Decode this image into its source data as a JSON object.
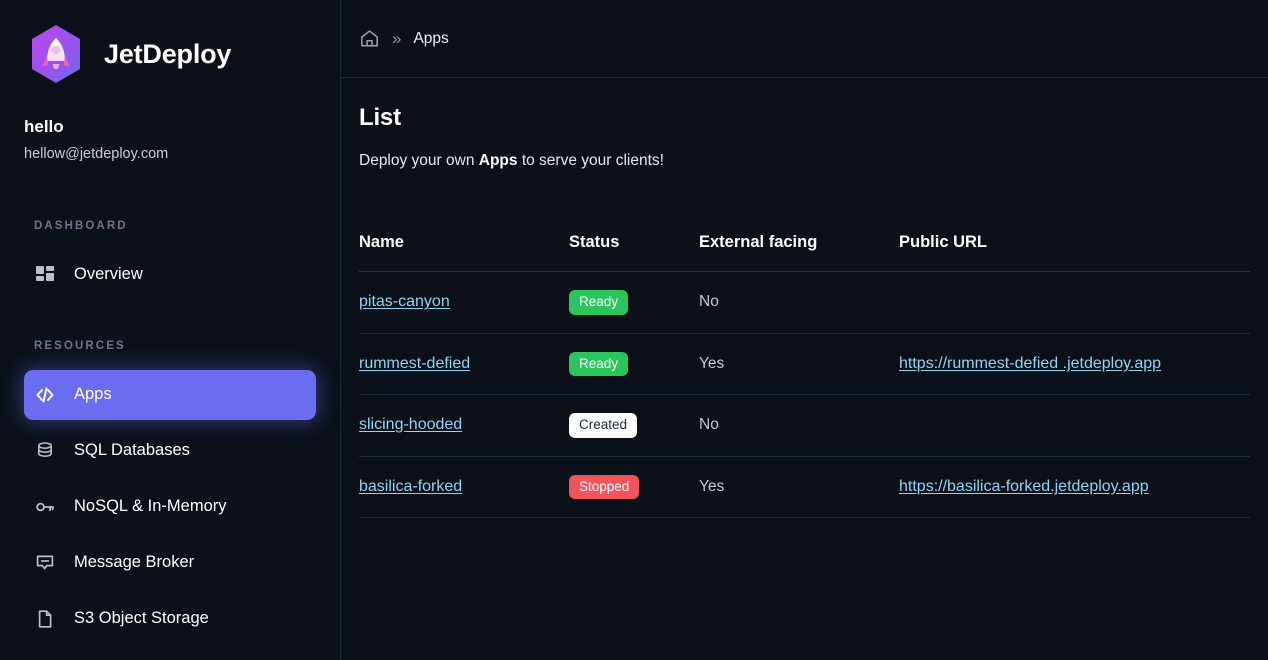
{
  "brand": {
    "name": "JetDeploy",
    "logo_icon": "rocket-hexagon-icon"
  },
  "account": {
    "name": "hello",
    "email": "hellow@jetdeploy.com"
  },
  "sidebar": {
    "sections": [
      {
        "label": "DASHBOARD",
        "items": [
          {
            "label": "Overview",
            "icon": "grid-dashboard-icon",
            "active": false
          }
        ]
      },
      {
        "label": "RESOURCES",
        "items": [
          {
            "label": "Apps",
            "icon": "code-brackets-icon",
            "active": true
          },
          {
            "label": "SQL Databases",
            "icon": "database-icon",
            "active": false
          },
          {
            "label": "NoSQL & In-Memory",
            "icon": "key-icon",
            "active": false
          },
          {
            "label": "Message Broker",
            "icon": "message-bubble-icon",
            "active": false
          },
          {
            "label": "S3 Object Storage",
            "icon": "file-document-icon",
            "active": false
          }
        ]
      }
    ]
  },
  "breadcrumb": {
    "home_icon": "home-icon",
    "separator": "»",
    "current": "Apps"
  },
  "page": {
    "title": "List",
    "subtitle_prefix": "Deploy your own ",
    "subtitle_bold": "Apps",
    "subtitle_suffix": " to serve your clients!"
  },
  "table": {
    "columns": [
      "Name",
      "Status",
      "External facing",
      "Public URL"
    ],
    "rows": [
      {
        "name": "pitas-canyon",
        "status": "Ready",
        "status_kind": "ready",
        "external_facing": "No",
        "public_url": ""
      },
      {
        "name": "rummest-defied",
        "status": "Ready",
        "status_kind": "ready",
        "external_facing": "Yes",
        "public_url": "https://rummest-defied .jetdeploy.app"
      },
      {
        "name": "slicing-hooded",
        "status": "Created",
        "status_kind": "created",
        "external_facing": "No",
        "public_url": ""
      },
      {
        "name": "basilica-forked",
        "status": "Stopped",
        "status_kind": "stopped",
        "external_facing": "Yes",
        "public_url": "https://basilica-forked.jetdeploy.app"
      }
    ]
  },
  "colors": {
    "background": "#0b1019",
    "accent": "#6b6df0",
    "link": "#8fd4f5",
    "badge_ready": "#2bc55e",
    "badge_created": "#ffffff",
    "badge_stopped": "#f2545b",
    "logo_gradient_from": "#a643e8",
    "logo_gradient_to": "#6f6ef0"
  }
}
